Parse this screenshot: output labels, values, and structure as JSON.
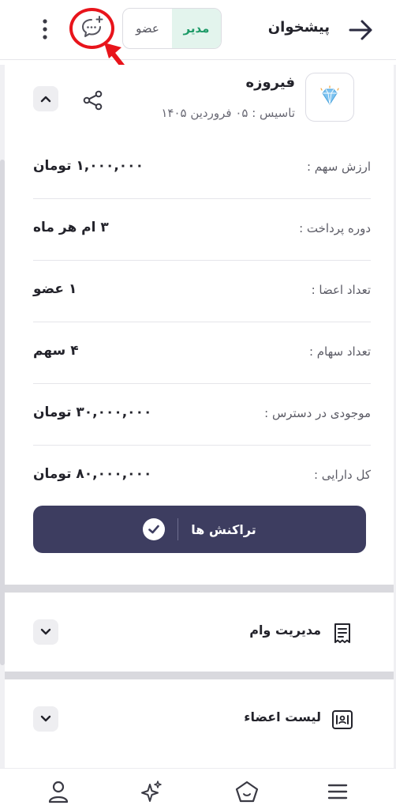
{
  "header": {
    "title": "پیشخوان",
    "role_options": [
      "مدیر",
      "عضو"
    ],
    "active_role": "مدیر"
  },
  "fund": {
    "name": "فیروزه",
    "founded": "تاسیس : ۰۵ فروردین ۱۴۰۵",
    "rows": [
      {
        "label": "ارزش سهم :",
        "value": "۱,۰۰۰,۰۰۰ تومان"
      },
      {
        "label": "دوره پرداخت :",
        "value": "۳ ام هر ماه"
      },
      {
        "label": "تعداد اعضا :",
        "value": "۱ عضو"
      },
      {
        "label": "تعداد سهام :",
        "value": "۴ سهم"
      },
      {
        "label": "موجودی در دسترس :",
        "value": "۳۰,۰۰۰,۰۰۰ تومان"
      },
      {
        "label": "کل دارایی :",
        "value": "۸۰,۰۰۰,۰۰۰ تومان"
      }
    ],
    "transactions_label": "تراکنش ها"
  },
  "sections": {
    "loan_management": "مدیریت وام",
    "members_list": "لیست اعضاء"
  },
  "icons": {
    "back": "arrow-right-icon",
    "chat_add": "chat-plus-icon",
    "more": "more-vertical-icon",
    "share": "share-icon",
    "collapse": "chevron-up-icon",
    "expand": "chevron-down-icon",
    "logo": "diamond-icon",
    "check": "check-circle-icon",
    "loan": "receipt-icon",
    "members": "members-list-icon",
    "nav": [
      "profile-icon",
      "sparkle-icon",
      "home-icon",
      "menu-icon"
    ]
  },
  "colors": {
    "primary": "#3d3d60",
    "accent_green": "#1d9a67",
    "highlight_red": "#e8141b",
    "logo_blue": "#7ec3f0"
  }
}
